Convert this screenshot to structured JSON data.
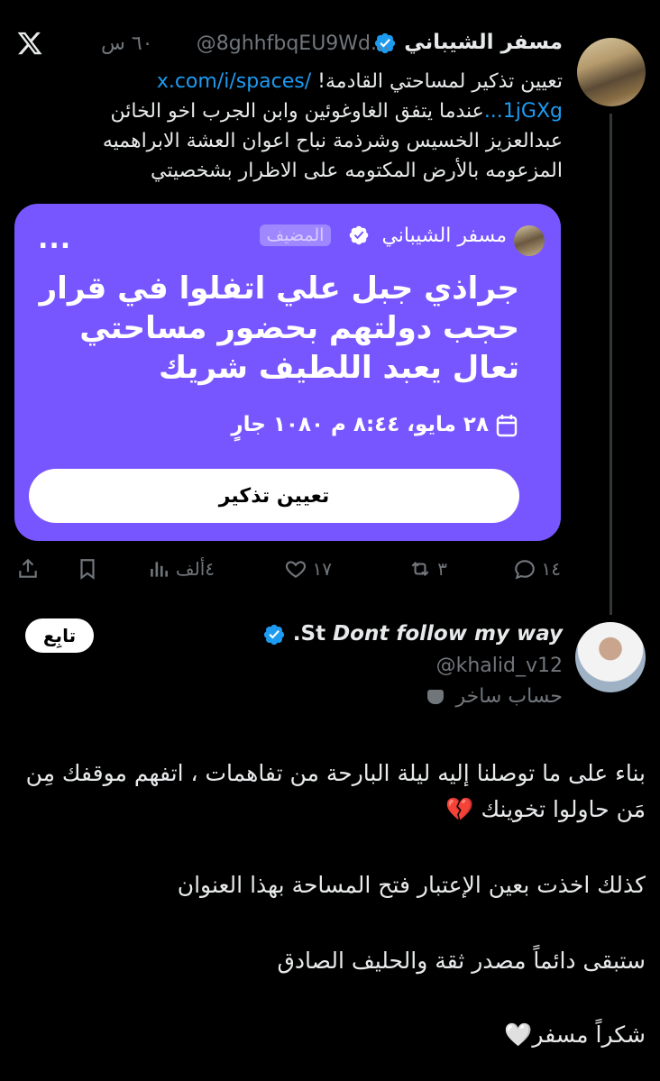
{
  "tweet1": {
    "author_name": "مسفر الشيباني",
    "handle": "@8ghhfbqEU9Wd...",
    "time": "٦٠ س",
    "text_before_link": "تعيين تذكير لمساحتي القادمة! ",
    "link_text": "x.com/i/spaces/",
    "link_cont": "1jGXg...",
    "text_after_link": "عندما يتفق الغاوغوئين وابن الجرب اخو الخائن عبدالعزيز الخسيس وشرذمة نباح اعوان العشة الابراهميه المزعومه بالأرض المكتومه على الاظرار بشخصيتي",
    "space_card": {
      "host_name": "مسفر الشيباني",
      "host_label": "المضيف",
      "more": "...",
      "title": "جراذي جبل علي اتفلوا في قرار حجب دولتهم بحضور مساحتي تعال يعبد اللطيف شريك",
      "date": "٢٨ مايو، ٨:٤٤ م ١٠٨٠ جارٍ",
      "button": "تعيين تذكير"
    },
    "actions": {
      "replies": "١٤",
      "reposts": "٣",
      "likes": "١٧",
      "views": "٤ألف"
    }
  },
  "tweet2": {
    "name_prefix": ".St",
    "name_italic": "Dont follow my way",
    "handle": "@khalid_v12",
    "parody_label": "حساب ساخر",
    "follow_label": "تابِع",
    "lines": [
      "بناء على ما توصلنا إليه ليلة البارحة من تفاهمات ، اتفهم موقفك مِن مَن حاولوا تخوينك 💔",
      "كذلك اخذت بعين الإعتبار فتح المساحة بهذا العنوان",
      "ستبقى دائماً مصدر ثقة والحليف الصادق",
      "شكراً مسفر🤍"
    ]
  },
  "colors": {
    "background": "#000000",
    "text": "#e7e9ea",
    "muted": "#71767b",
    "link": "#1d9bf0",
    "space_card": "#7856ff",
    "verified": "#1d9bf0"
  }
}
